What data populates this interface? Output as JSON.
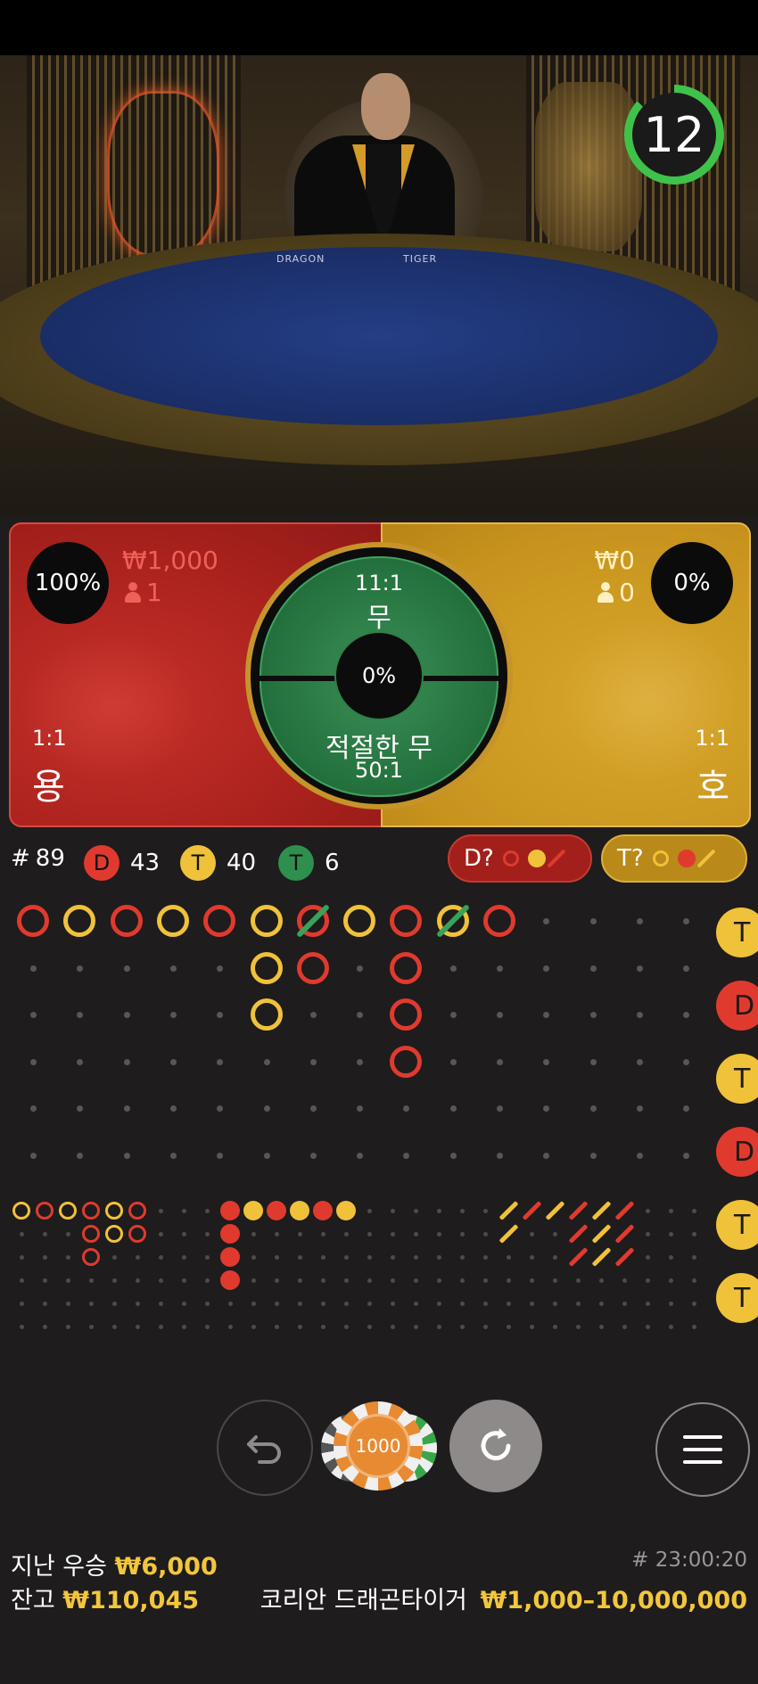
{
  "timer": {
    "value": "12",
    "color": "#3fc24a"
  },
  "video": {
    "felt_left": "DRAGON",
    "felt_right": "TIGER"
  },
  "dragon": {
    "percent": "100%",
    "amount": "₩1,000",
    "players": "1",
    "odds": "1:1",
    "name": "용",
    "color": "#c8302a"
  },
  "tiger": {
    "percent": "0%",
    "amount": "₩0",
    "players": "0",
    "odds": "1:1",
    "name": "호",
    "color": "#d8a72b"
  },
  "tie": {
    "odds": "11:1",
    "name": "무",
    "percent": "0%",
    "suited_name": "적절한 무",
    "suited_odds": "50:1",
    "color": "#1f6b38"
  },
  "stats": {
    "rounds_label": "#",
    "rounds": "89",
    "dragon_badge": "D",
    "dragon_count": "43",
    "tiger_badge": "T",
    "tiger_count": "40",
    "tie_badge": "T",
    "tie_count": "6"
  },
  "ask_dragon": {
    "label": "D?"
  },
  "ask_tiger": {
    "label": "T?"
  },
  "side_tabs": [
    "T",
    "D",
    "T",
    "D",
    "T",
    "T"
  ],
  "road": {
    "big_road": [
      {
        "col": 0,
        "row": 0,
        "side": "D"
      },
      {
        "col": 1,
        "row": 0,
        "side": "T"
      },
      {
        "col": 2,
        "row": 0,
        "side": "D"
      },
      {
        "col": 3,
        "row": 0,
        "side": "T"
      },
      {
        "col": 4,
        "row": 0,
        "side": "D"
      },
      {
        "col": 5,
        "row": 0,
        "side": "T"
      },
      {
        "col": 5,
        "row": 1,
        "side": "T"
      },
      {
        "col": 5,
        "row": 2,
        "side": "T"
      },
      {
        "col": 6,
        "row": 0,
        "side": "D",
        "tie": true
      },
      {
        "col": 6,
        "row": 1,
        "side": "D"
      },
      {
        "col": 7,
        "row": 0,
        "side": "T"
      },
      {
        "col": 8,
        "row": 0,
        "side": "D"
      },
      {
        "col": 8,
        "row": 1,
        "side": "D"
      },
      {
        "col": 8,
        "row": 2,
        "side": "D"
      },
      {
        "col": 8,
        "row": 3,
        "side": "D"
      },
      {
        "col": 9,
        "row": 0,
        "side": "T",
        "tie": true
      },
      {
        "col": 10,
        "row": 0,
        "side": "D"
      }
    ],
    "big_eye_road": [
      {
        "col": 0,
        "row": 0,
        "c": "Y"
      },
      {
        "col": 1,
        "row": 0,
        "c": "R"
      },
      {
        "col": 2,
        "row": 0,
        "c": "Y"
      },
      {
        "col": 3,
        "row": 0,
        "c": "R"
      },
      {
        "col": 3,
        "row": 1,
        "c": "R"
      },
      {
        "col": 3,
        "row": 2,
        "c": "R"
      },
      {
        "col": 4,
        "row": 0,
        "c": "Y"
      },
      {
        "col": 4,
        "row": 1,
        "c": "Y"
      },
      {
        "col": 5,
        "row": 0,
        "c": "R"
      },
      {
        "col": 5,
        "row": 1,
        "c": "R"
      }
    ],
    "small_road": [
      {
        "col": 0,
        "row": 0,
        "c": "R"
      },
      {
        "col": 0,
        "row": 1,
        "c": "R"
      },
      {
        "col": 0,
        "row": 2,
        "c": "R"
      },
      {
        "col": 0,
        "row": 3,
        "c": "R"
      },
      {
        "col": 1,
        "row": 0,
        "c": "Y"
      },
      {
        "col": 2,
        "row": 0,
        "c": "R"
      },
      {
        "col": 3,
        "row": 0,
        "c": "Y"
      },
      {
        "col": 4,
        "row": 0,
        "c": "R"
      },
      {
        "col": 5,
        "row": 0,
        "c": "Y"
      }
    ],
    "cockroach_road": [
      {
        "col": 0,
        "row": 0,
        "c": "Y"
      },
      {
        "col": 0,
        "row": 1,
        "c": "Y"
      },
      {
        "col": 1,
        "row": 0,
        "c": "R"
      },
      {
        "col": 2,
        "row": 0,
        "c": "Y"
      },
      {
        "col": 3,
        "row": 0,
        "c": "R"
      },
      {
        "col": 3,
        "row": 1,
        "c": "R"
      },
      {
        "col": 3,
        "row": 2,
        "c": "R"
      },
      {
        "col": 4,
        "row": 0,
        "c": "Y"
      },
      {
        "col": 4,
        "row": 1,
        "c": "Y"
      },
      {
        "col": 4,
        "row": 2,
        "c": "Y"
      },
      {
        "col": 5,
        "row": 0,
        "c": "R"
      },
      {
        "col": 5,
        "row": 1,
        "c": "R"
      },
      {
        "col": 5,
        "row": 2,
        "c": "R"
      }
    ]
  },
  "controls": {
    "chip_value": "1000"
  },
  "footer": {
    "last_win_label": "지난 우승",
    "last_win_value": "₩6,000",
    "balance_label": "잔고",
    "balance_value": "₩110,045",
    "round_id": "# 23:00:20",
    "table_name": "코리안 드래곤타이거",
    "limits": "₩1,000–10,000,000"
  },
  "colors": {
    "red": "#e03a2e",
    "yellow": "#f0c23a",
    "green": "#2f8f4e",
    "accent_gold": "#f3c63b"
  }
}
